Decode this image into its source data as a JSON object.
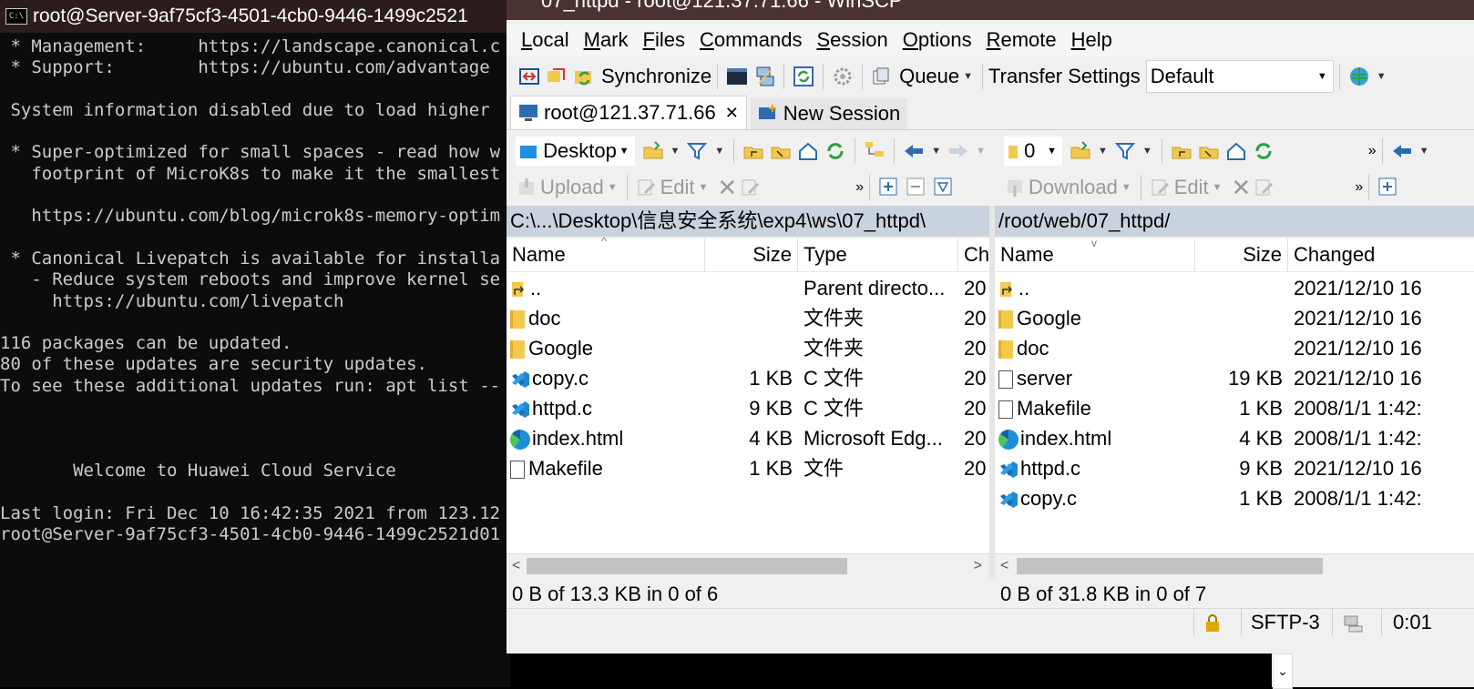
{
  "terminal": {
    "title": "root@Server-9af75cf3-4501-4cb0-9446-1499c2521",
    "lines": [
      " * Management:     https://landscape.canonical.c",
      " * Support:        https://ubuntu.com/advantage",
      "",
      " System information disabled due to load higher",
      "",
      " * Super-optimized for small spaces - read how w",
      "   footprint of MicroK8s to make it the smallest",
      "",
      "   https://ubuntu.com/blog/microk8s-memory-optim",
      "",
      " * Canonical Livepatch is available for installa",
      "   - Reduce system reboots and improve kernel se",
      "     https://ubuntu.com/livepatch",
      "",
      "116 packages can be updated.",
      "80 of these updates are security updates.",
      "To see these additional updates run: apt list --",
      "",
      "",
      "",
      "       Welcome to Huawei Cloud Service",
      "",
      "Last login: Fri Dec 10 16:42:35 2021 from 123.12",
      "root@Server-9af75cf3-4501-4cb0-9446-1499c2521d01"
    ]
  },
  "winscp": {
    "title": "07_httpd - root@121.37.71.66 - WinSCP",
    "menu": [
      "Local",
      "Mark",
      "Files",
      "Commands",
      "Session",
      "Options",
      "Remote",
      "Help"
    ],
    "toolbar": {
      "synchronize": "Synchronize",
      "queue": "Queue",
      "transfer_settings": "Transfer Settings",
      "transfer_value": "Default"
    },
    "tabs": {
      "session": "root@121.37.71.66",
      "new_session": "New Session"
    },
    "local": {
      "drive": "Desktop",
      "upload": "Upload",
      "edit": "Edit",
      "path": "C:\\...\\Desktop\\信息安全系统\\exp4\\ws\\07_httpd\\",
      "columns": [
        "Name",
        "Size",
        "Type",
        "Ch"
      ],
      "rows": [
        {
          "name": "..",
          "size": "",
          "type": "Parent directo...",
          "changed": "20",
          "icon": "parent-dir-icon"
        },
        {
          "name": "doc",
          "size": "",
          "type": "文件夹",
          "changed": "20",
          "icon": "folder-icon"
        },
        {
          "name": "Google",
          "size": "",
          "type": "文件夹",
          "changed": "20",
          "icon": "folder-icon"
        },
        {
          "name": "copy.c",
          "size": "1 KB",
          "type": "C 文件",
          "changed": "20",
          "icon": "vscode-file-icon"
        },
        {
          "name": "httpd.c",
          "size": "9 KB",
          "type": "C 文件",
          "changed": "20",
          "icon": "vscode-file-icon"
        },
        {
          "name": "index.html",
          "size": "4 KB",
          "type": "Microsoft Edg...",
          "changed": "20",
          "icon": "edge-file-icon"
        },
        {
          "name": "Makefile",
          "size": "1 KB",
          "type": "文件",
          "changed": "20",
          "icon": "generic-file-icon"
        }
      ],
      "status": "0 B of 13.3 KB in 0 of 6"
    },
    "remote": {
      "drive": "0",
      "download": "Download",
      "edit": "Edit",
      "path": "/root/web/07_httpd/",
      "columns": [
        "Name",
        "Size",
        "Changed"
      ],
      "rows": [
        {
          "name": "..",
          "size": "",
          "changed": "2021/12/10 16",
          "icon": "parent-dir-icon"
        },
        {
          "name": "Google",
          "size": "",
          "changed": "2021/12/10 16",
          "icon": "folder-icon"
        },
        {
          "name": "doc",
          "size": "",
          "changed": "2021/12/10 16",
          "icon": "folder-icon"
        },
        {
          "name": "server",
          "size": "19 KB",
          "changed": "2021/12/10 16",
          "icon": "generic-file-icon"
        },
        {
          "name": "Makefile",
          "size": "1 KB",
          "changed": "2008/1/1 1:42:",
          "icon": "generic-file-icon"
        },
        {
          "name": "index.html",
          "size": "4 KB",
          "changed": "2008/1/1 1:42:",
          "icon": "edge-file-icon"
        },
        {
          "name": "httpd.c",
          "size": "9 KB",
          "changed": "2021/12/10 16",
          "icon": "vscode-file-icon"
        },
        {
          "name": "copy.c",
          "size": "1 KB",
          "changed": "2008/1/1 1:42:",
          "icon": "vscode-file-icon"
        }
      ],
      "status": "0 B of 31.8 KB in 0 of 7"
    },
    "statusbar": {
      "protocol": "SFTP-3",
      "time": "0:01"
    },
    "colors": {
      "path_bar": "#c9d3de",
      "title_bar": "#4a3232",
      "terminal_bg": "#0c0c0c"
    }
  }
}
